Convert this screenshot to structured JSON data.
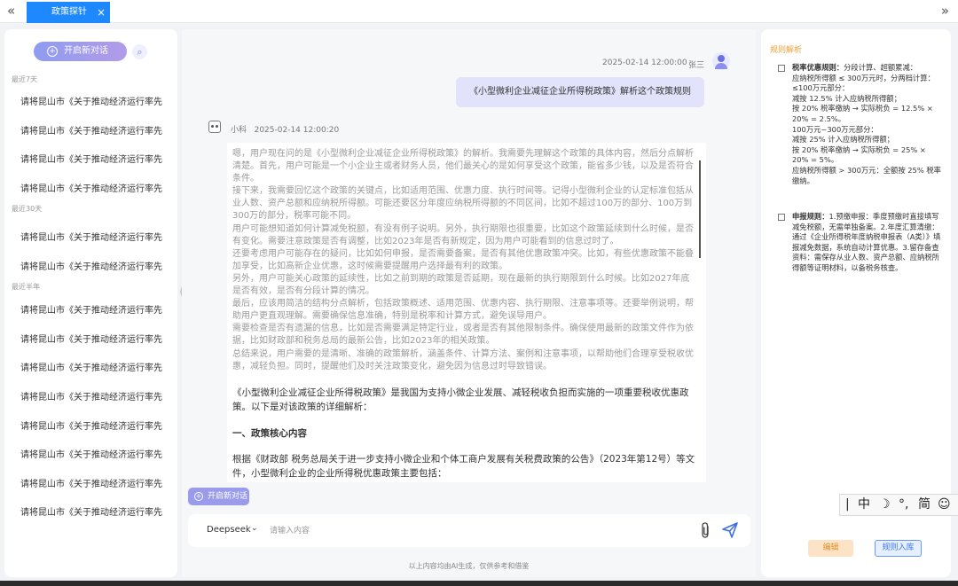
{
  "tabbar": {
    "prev_glyph": "«",
    "next_glyph": "»",
    "active_tab": "政策探针",
    "close_glyph": "×"
  },
  "sidebar": {
    "new_chat_label": "开启新对话",
    "sections": [
      {
        "label": "最近7天",
        "items": [
          "请将昆山市《关于推动经济运行率先",
          "请将昆山市《关于推动经济运行率先",
          "请将昆山市《关于推动经济运行率先",
          "请将昆山市《关于推动经济运行率先"
        ]
      },
      {
        "label": "最近30天",
        "items": [
          "请将昆山市《关于推动经济运行率先",
          "请将昆山市《关于推动经济运行率先"
        ]
      },
      {
        "label": "最近半年",
        "items": [
          "请将昆山市《关于推动经济运行率先",
          "请将昆山市《关于推动经济运行率先",
          "请将昆山市《关于推动经济运行率先",
          "请将昆山市《关于推动经济运行率先",
          "请将昆山市《关于推动经济运行率先",
          "请将昆山市《关于推动经济运行率先",
          "请将昆山市《关于推动经济运行率先",
          "请将昆山市《关于推动经济运行率先"
        ]
      }
    ]
  },
  "chat": {
    "user_time": "2025-02-14 12:00:00",
    "user_name": "张三",
    "user_message": "《小型微利企业减征企业所得税政策》解析这个政策规则",
    "bot_name": "小科",
    "bot_time": "2025-02-14 12:00:20",
    "thinking": [
      "嗯，用户现在问的是《小型微利企业减征企业所得税政策》的解析。我需要先理解这个政策的具体内容，然后分点解析清楚。首先，用户可能是一个小企业主或者财务人员，他们最关心的是如何享受这个政策，能省多少钱，以及是否符合条件。",
      "接下来，我需要回忆这个政策的关键点，比如适用范围、优惠力度、执行时间等。记得小型微利企业的认定标准包括从业人数、资产总额和应纳税所得额。可能还要区分年度应纳税所得额的不同区间，比如不超过100万的部分、100万到300万的部分，税率可能不同。",
      "用户可能想知道如何计算减免税额，有没有例子说明。另外，执行期限也很重要，比如这个政策延续到什么时候，是否有变化。需要注意政策是否有调整，比如2023年是否有新规定，因为用户可能看到的信息过时了。",
      "还要考虑用户可能存在的疑问，比如如何申报，是否需要备案，是否有其他优惠政策冲突。比如，有些优惠政策不能叠加享受，比如高新企业优惠，这时候需要提醒用户选择最有利的政策。",
      "另外，用户可能关心政策的延续性，比如之前到期的政策是否延期，现在最新的执行期限到什么时候。比如2027年底是否有效，是否有分段计算的情况。",
      "最后，应该用简洁的结构分点解析，包括政策概述、适用范围、优惠内容、执行期限、注意事项等。还要举例说明，帮助用户更直观理解。需要确保信息准确，特别是税率和计算方式，避免误导用户。",
      "需要检查是否有遗漏的信息，比如是否需要满足特定行业，或者是否有其他限制条件。确保使用最新的政策文件作为依据，比如财政部和税务总局的最新公告，比如2023年的相关政策。",
      "总结来说，用户需要的是清晰、准确的政策解析，涵盖条件、计算方法、案例和注意事项，以帮助他们合理享受税收优惠，减轻负担。同时，提醒他们及时关注政策变化，避免因为信息过时导致错误。"
    ],
    "response_intro": "《小型微利企业减征企业所得税政策》是我国为支持小微企业发展、减轻税收负担而实施的一项重要税收优惠政策。以下是对该政策的详细解析：",
    "response_heading": "一、政策核心内容",
    "response_basis": "根据《财政部 税务总局关于进一步支持小微企业和个体工商户发展有关税费政策的公告》（2023年第12号）等文件，小型微利企业的企业所得税优惠政策主要包括：",
    "new_chat_chip": "开启新对话",
    "model": "Deepseek",
    "input_placeholder": "请输入内容",
    "disclaimer": "以上内容均由AI生成，仅供参考和借鉴"
  },
  "rules_panel": {
    "title": "规则解析",
    "rules": [
      {
        "title": "税率优惠规则：",
        "lines": [
          "分段计算、超额累减：",
          "应纳税所得额 ≤ 300万元时，分两档计算：",
          "≤100万元部分：",
          "减按 12.5% 计入应纳税所得额；",
          "按 20% 税率缴纳 → 实际税负 = 12.5% × 20% = 2.5%。",
          "100万元~300万元部分：",
          "减按 25% 计入应纳税所得额；",
          "按 20% 税率缴纳 → 实际税负 = 25% × 20% = 5%。",
          "应纳税所得额 > 300万元：全额按 25% 税率缴纳。"
        ]
      },
      {
        "title": "申报规则：",
        "lines": [
          "1.预缴申报：季度预缴时直接填写减免税额，无需单独备案。2.年度汇算清缴：通过《企业所得税年度纳税申报表（A类）》填报减免数据，系统自动计算优惠。3.留存备查资料：需保存从业人数、资产总额、应纳税所得额等证明材料，以备税务核查。"
        ]
      }
    ],
    "edit_label": "编辑",
    "save_label": "规则入库"
  },
  "ime": {
    "cursor": "|",
    "mode": "中",
    "moon": "☽",
    "punct": "°,",
    "variant": "简",
    "emoji": "☺"
  }
}
